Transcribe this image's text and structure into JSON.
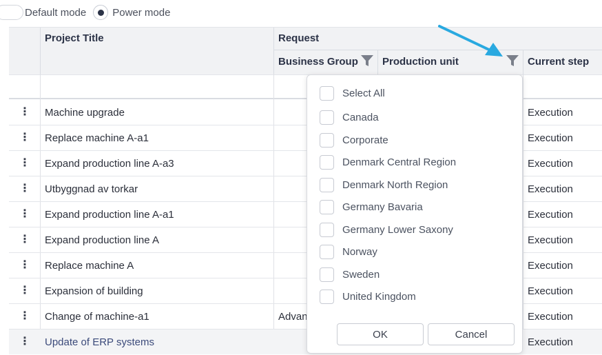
{
  "modes": {
    "default_label": "Default mode",
    "power_label": "Power mode",
    "selected": "power"
  },
  "columns": {
    "project_title": "Project Title",
    "request_group": "Request",
    "business_group": "Business Group",
    "production_unit": "Production unit",
    "current_step": "Current step"
  },
  "rows": [
    {
      "title": "Machine upgrade",
      "business_group": "",
      "step": "Execution"
    },
    {
      "title": "Replace machine A-a1",
      "business_group": "",
      "step": "Execution"
    },
    {
      "title": "Expand production line A-a3",
      "business_group": "",
      "step": "Execution"
    },
    {
      "title": "Utbyggnad av torkar",
      "business_group": "",
      "step": "Execution"
    },
    {
      "title": "Expand production line A-a1",
      "business_group": "",
      "step": "Execution"
    },
    {
      "title": "Expand production line A",
      "business_group": "",
      "step": "Execution"
    },
    {
      "title": "Replace machine A",
      "business_group": "",
      "step": "Execution"
    },
    {
      "title": "Expansion of building",
      "business_group": "",
      "step": "Execution"
    },
    {
      "title": "Change of machine-a1",
      "business_group": "Advan",
      "step": "Execution"
    },
    {
      "title": "Update of ERP systems",
      "business_group": "",
      "step": "Execution"
    }
  ],
  "row_menu_glyph": "⋮",
  "filter_popup": {
    "select_all": "Select All",
    "options": [
      "Canada",
      "Corporate",
      "Denmark Central Region",
      "Denmark North Region",
      "Germany Bavaria",
      "Germany Lower Saxony",
      "Norway",
      "Sweden",
      "United Kingdom"
    ],
    "ok": "OK",
    "cancel": "Cancel"
  },
  "colors": {
    "header_bg": "#f1f2f4",
    "arrow": "#29a9e0",
    "selected_row_bg": "#f3f4f6",
    "link_text": "#3b4a7a"
  }
}
